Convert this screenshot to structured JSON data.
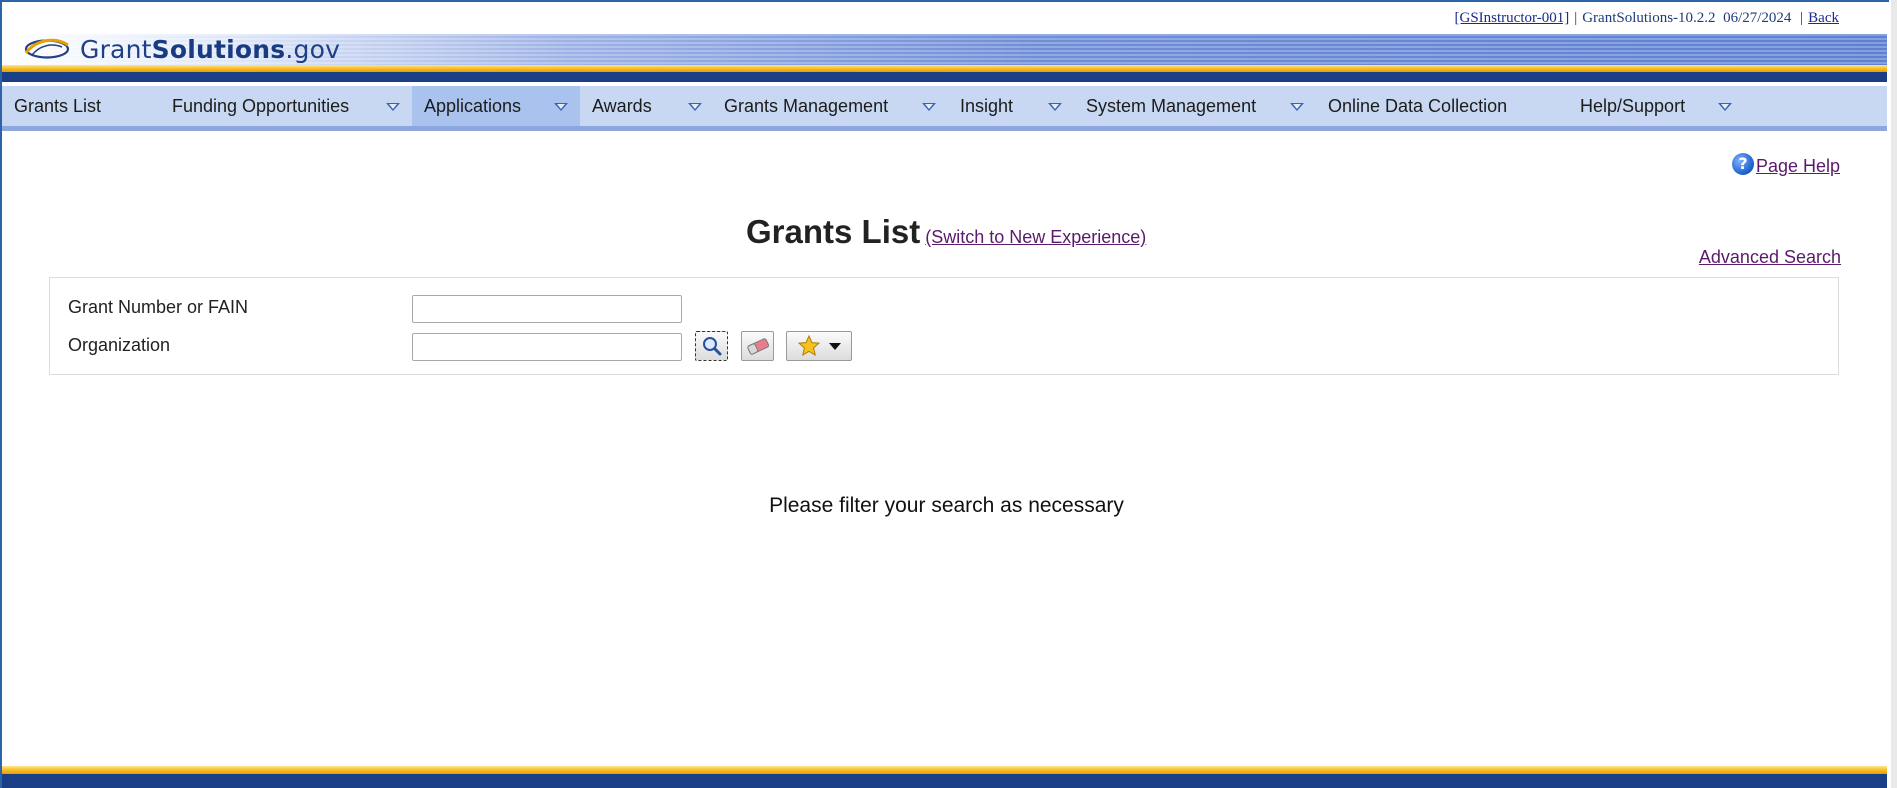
{
  "header": {
    "user_link": "[GSInstructor-001]",
    "version": "GrantSolutions-10.2.2",
    "date": "06/27/2024",
    "back_link": "Back",
    "logo": {
      "part1": "Grant",
      "part2": "Solutions",
      "part3": ".gov"
    }
  },
  "nav": {
    "items": [
      {
        "label": "Grants List",
        "has_dropdown": false
      },
      {
        "label": "Funding Opportunities",
        "has_dropdown": true
      },
      {
        "label": "Applications",
        "has_dropdown": true,
        "active": true
      },
      {
        "label": "Awards",
        "has_dropdown": true
      },
      {
        "label": "Grants Management",
        "has_dropdown": true
      },
      {
        "label": "Insight",
        "has_dropdown": true
      },
      {
        "label": "System Management",
        "has_dropdown": true
      },
      {
        "label": "Online Data Collection",
        "has_dropdown": false
      },
      {
        "label": "Help/Support",
        "has_dropdown": true
      }
    ]
  },
  "page": {
    "help_link": "Page Help",
    "title": "Grants List",
    "switch_link": "(Switch to New Experience)",
    "advanced_search": "Advanced Search"
  },
  "filters": {
    "grant_label": "Grant Number or FAIN",
    "grant_value": "",
    "org_label": "Organization",
    "org_value": ""
  },
  "results": {
    "message": "Please filter your search as necessary"
  },
  "colors": {
    "nav_bg": "#c8d8f3",
    "nav_active": "#a9c3ee",
    "navy": "#1b3f86",
    "gold": "#f5b616",
    "link_visited": "#5b1a6b"
  }
}
